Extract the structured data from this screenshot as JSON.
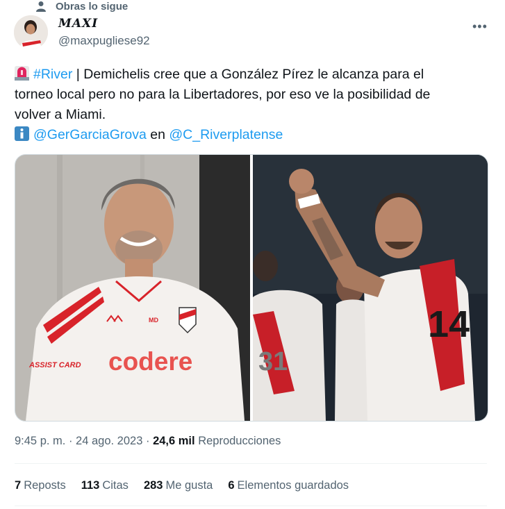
{
  "social_context": {
    "text": "Obras lo sigue"
  },
  "author": {
    "name": "MAXI",
    "handle": "@maxpugliese92"
  },
  "more_icon": "more-horizontal-icon",
  "tweet": {
    "emoji_1": "police-light-icon",
    "hashtag": "#River",
    "line1_rest": " | Demichelis cree que a González Pírez le alcanza para el",
    "line2": "torneo local pero no para la Libertadores, por eso ve la posibilidad de",
    "line3": "volver a Miami.",
    "emoji_2": "info-icon",
    "mention_1": "@GerGarciaGrova",
    "connector": " en ",
    "mention_2": "@C_Riverplatense"
  },
  "media": {
    "left_jersey_sponsor": "codere",
    "left_jersey_initials": "MD",
    "left_sleeve_text": "ASSIST CARD",
    "right_jersey_number": "14",
    "right_back_number": "31"
  },
  "meta": {
    "time": "9:45 p. m.",
    "sep1": " · ",
    "date": "24 ago. 2023",
    "sep2": " · ",
    "views_count": "24,6 mil",
    "views_label": " Reproducciones"
  },
  "stats": {
    "reposts_count": "7",
    "reposts_label": "Reposts",
    "quotes_count": "113",
    "quotes_label": "Citas",
    "likes_count": "283",
    "likes_label": "Me gusta",
    "bookmarks_count": "6",
    "bookmarks_label": "Elementos guardados"
  },
  "colors": {
    "link": "#1d9bf0",
    "secondary": "#536471",
    "alert": "#e0245e",
    "info": "#3b88c3"
  }
}
